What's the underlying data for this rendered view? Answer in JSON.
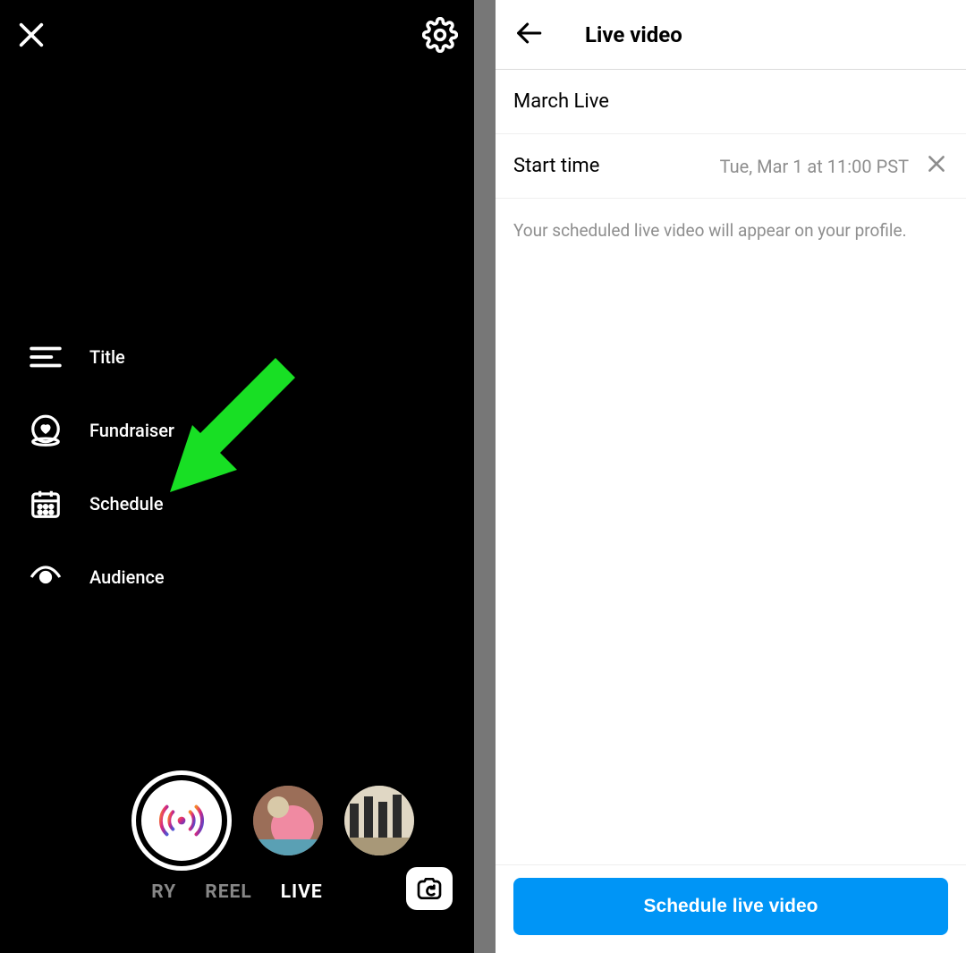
{
  "left": {
    "options": {
      "title": "Title",
      "fundraiser": "Fundraiser",
      "schedule": "Schedule",
      "audience": "Audience"
    },
    "tabs": {
      "story_partial": "RY",
      "reel": "REEL",
      "live": "LIVE"
    }
  },
  "right": {
    "header_title": "Live video",
    "event_title": "March Live",
    "start_time_label": "Start time",
    "start_time_value": "Tue, Mar 1 at 11:00 PST",
    "helper": "Your scheduled live video will appear on your profile.",
    "schedule_button": "Schedule live video"
  },
  "annotation": {
    "arrow_color": "#18df24"
  }
}
